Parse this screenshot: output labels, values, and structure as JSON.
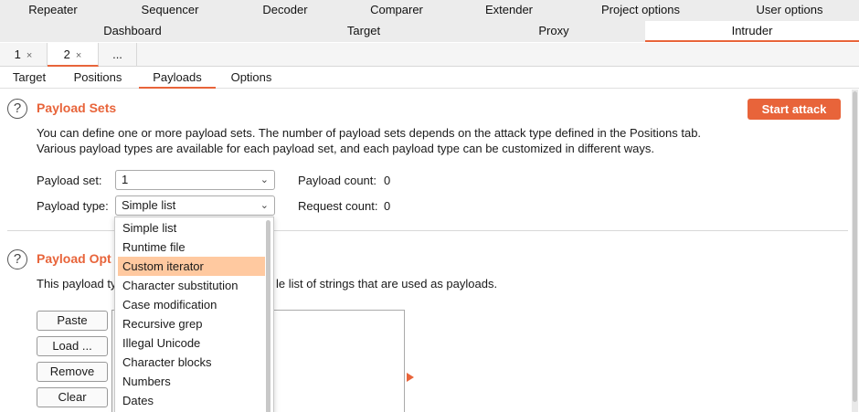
{
  "top_tabs_row1": [
    "Repeater",
    "Sequencer",
    "Decoder",
    "Comparer",
    "Extender",
    "Project options",
    "User options"
  ],
  "top_tabs_row2": [
    "Dashboard",
    "Target",
    "Proxy",
    "Intruder"
  ],
  "active_top_tab": "Intruder",
  "instance_tabs": [
    {
      "label": "1",
      "close": "×"
    },
    {
      "label": "2",
      "close": "×"
    },
    {
      "label": "..."
    }
  ],
  "sub_tabs": [
    "Target",
    "Positions",
    "Payloads",
    "Options"
  ],
  "active_sub_tab": "Payloads",
  "payload_sets": {
    "title": "Payload Sets",
    "help_icon": "?",
    "desc_line1": "You can define one or more payload sets. The number of payload sets depends on the attack type defined in the Positions tab.",
    "desc_line2": "Various payload types are available for each payload set, and each payload type can be customized in different ways.",
    "payload_set_label": "Payload set:",
    "payload_set_value": "1",
    "payload_type_label": "Payload type:",
    "payload_type_value": "Simple list",
    "payload_count_label": "Payload count:",
    "payload_count_value": "0",
    "request_count_label": "Request count:",
    "request_count_value": "0",
    "start_attack": "Start attack"
  },
  "payload_options": {
    "title_visible": "Payload Opt",
    "help_icon": "?",
    "desc_left": "This payload ty",
    "desc_right": "le list of strings that are used as payloads.",
    "buttons": [
      "Paste",
      "Load ...",
      "Remove",
      "Clear"
    ]
  },
  "payload_type_dropdown": {
    "options": [
      "Simple list",
      "Runtime file",
      "Custom iterator",
      "Character substitution",
      "Case modification",
      "Recursive grep",
      "Illegal Unicode",
      "Character blocks",
      "Numbers",
      "Dates"
    ],
    "highlighted": "Custom iterator"
  },
  "colors": {
    "accent": "#e8643a",
    "highlight": "#ffc9a0"
  }
}
